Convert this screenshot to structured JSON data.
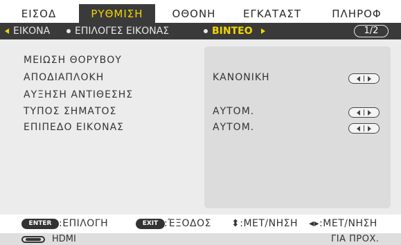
{
  "tabs": [
    {
      "label": "ΕΙΣΟΔ",
      "active": false
    },
    {
      "label": "ΡΥΘΜΙΣΗ",
      "active": true
    },
    {
      "label": "ΟΘΟΝΗ",
      "active": false
    },
    {
      "label": "ΕΓΚΑΤΑΣΤ",
      "active": false
    },
    {
      "label": "ΠΛΗΡΟΦ",
      "active": false
    }
  ],
  "breadcrumb": {
    "items": [
      "ΕΙΚΟΝΑ",
      "ΕΠΙΛΟΓΕΣ ΕΙΚΟΝΑΣ",
      "ΒΙΝΤΕΟ"
    ],
    "page": "1/2"
  },
  "settings": [
    {
      "label": "ΜΕΙΩΣΗ ΘΟΡΥΒΟΥ",
      "value": "",
      "adjustable": false
    },
    {
      "label": "ΑΠΟΔΙΑΠΛΟΚΗ",
      "value": "ΚΑΝΟΝΙΚΗ",
      "adjustable": true
    },
    {
      "label": "ΑΥΞΗΣΗ ΑΝΤΙΘΕΣΗΣ",
      "value": "",
      "adjustable": false
    },
    {
      "label": "ΤΥΠΟΣ ΣΗΜΑΤΟΣ",
      "value": "ΑΥΤΟΜ.",
      "adjustable": true
    },
    {
      "label": "ΕΠΙΠΕΔΟ ΕΙΚΟΝΑΣ",
      "value": "ΑΥΤΟΜ.",
      "adjustable": true
    }
  ],
  "footer": {
    "enter_key": "ENTER",
    "enter_text": ":ΕΠΙΛΟΓΗ",
    "exit_key": "EXIT",
    "exit_text": ":ΈΞΟΔΟΣ",
    "updown_text": "⬍:ΜΕΤ/ΝΗΣΗ",
    "leftright_text": "◂▸:ΜΕΤ/ΝΗΣΗ"
  },
  "status": {
    "source": "HDMI",
    "mode": "ΓΙΑ ΠΡΟΧ."
  },
  "colors": {
    "accent": "#f2d600",
    "dark_bar": "#3a3a3a",
    "panel": "#ececec",
    "value_panel": "#dcdcdc"
  },
  "icons": {
    "breadcrumb_left": "arrow-left-icon",
    "breadcrumb_right": "arrow-right-icon",
    "adjust": "left-right-adjust-icon",
    "source": "hdmi-connector-icon"
  }
}
